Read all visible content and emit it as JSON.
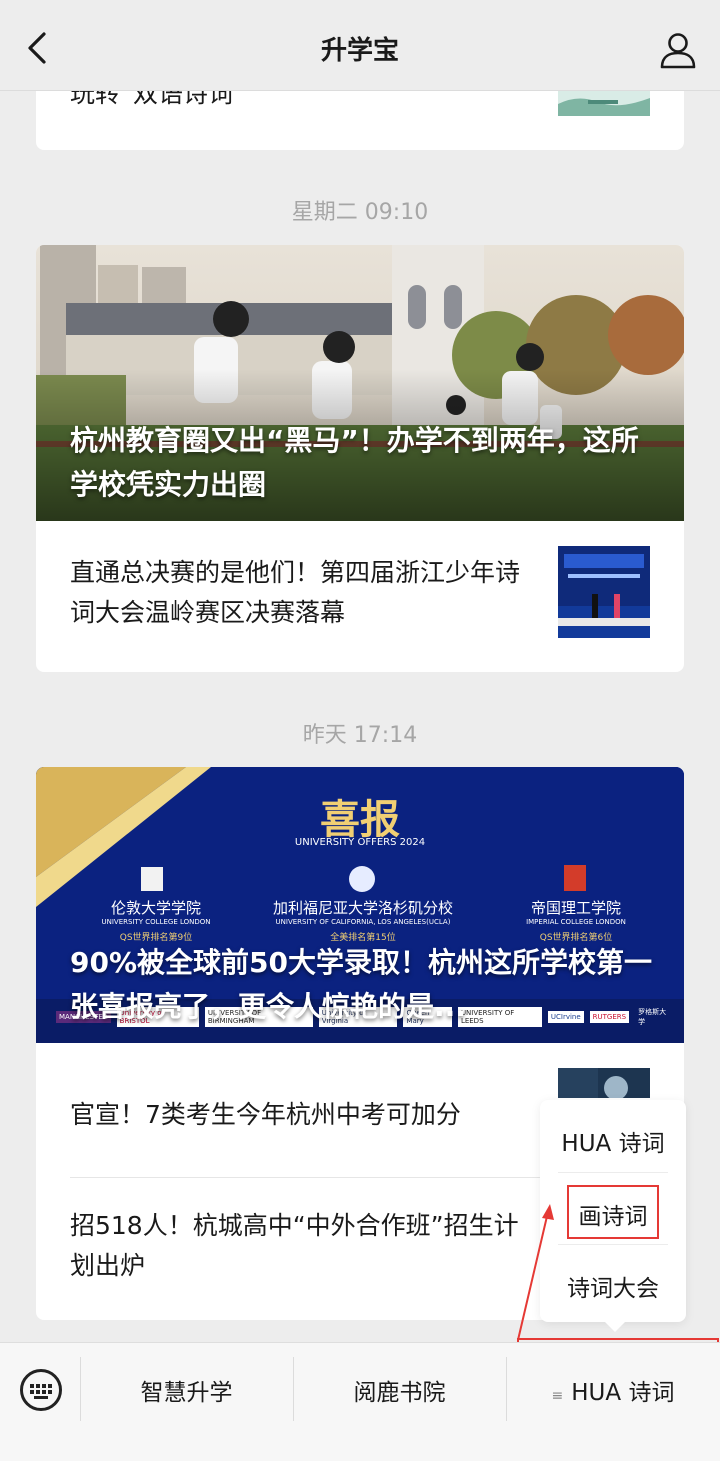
{
  "header": {
    "title": "升学宝"
  },
  "feed": {
    "card0": {
      "partial_text": "玩转“双语诗词”"
    },
    "group1": {
      "time": "星期二 09:10",
      "hero_title": "杭州教育圈又出“黑马”！办学不到两年，这所学校凭实力出圈",
      "items": [
        {
          "title": "直通总决赛的是他们！第四届浙江少年诗词大会温岭赛区决赛落幕"
        }
      ]
    },
    "group2": {
      "time": "昨天 17:14",
      "hero_banner": {
        "title": "喜报",
        "subtitle": "UNIVERSITY OFFERS 2024",
        "universities": [
          {
            "cn": "伦敦大学学院",
            "en": "UNIVERSITY COLLEGE LONDON",
            "rank": "QS世界排名第9位"
          },
          {
            "cn": "加利福尼亚大学洛杉矶分校",
            "en": "UNIVERSITY OF CALIFORNIA, LOS ANGELES(UCLA)",
            "rank": "全美排名第15位"
          },
          {
            "cn": "帝国理工学院",
            "en": "IMPERIAL COLLEGE LONDON",
            "rank": "QS世界排名第6位"
          }
        ],
        "logos": [
          "MANCHESTER",
          "University of BRISTOL",
          "UNIVERSITY OF BIRMINGHAM",
          "University of Virginia",
          "Queen Mary",
          "UNIVERSITY OF LEEDS",
          "UCIrvine",
          "RUTGERS",
          "罗格斯大学"
        ]
      },
      "hero_title": "90%被全球前50大学录取！杭州这所学校第一张喜报亮了，更令人惊艳的是...",
      "items": [
        {
          "title": "官宣！7类考生今年杭州中考可加分"
        },
        {
          "title": "招518人！杭城高中“中外合作班”招生计划出炉"
        }
      ]
    }
  },
  "popup_menu": {
    "items": [
      "HUA 诗词",
      "画诗词",
      "诗词大会"
    ]
  },
  "bottom_menu": {
    "items": [
      "智慧升学",
      "阅鹿书院",
      "HUA 诗词"
    ],
    "menu_glyph": "≡"
  },
  "colors": {
    "annotation": "#e53935",
    "background": "#ededed"
  }
}
